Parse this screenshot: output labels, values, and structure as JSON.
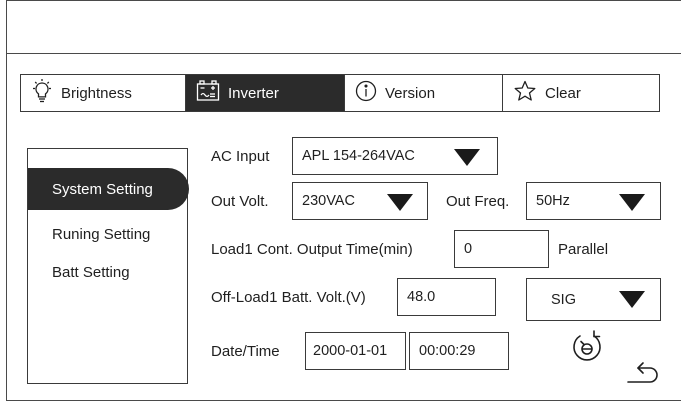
{
  "tabs": [
    {
      "label": "Brightness",
      "icon": "sun-icon",
      "active": false
    },
    {
      "label": "Inverter",
      "icon": "battery-icon",
      "active": true
    },
    {
      "label": "Version",
      "icon": "info-icon",
      "active": false
    },
    {
      "label": "Clear",
      "icon": "star-icon",
      "active": false
    }
  ],
  "sidebar": {
    "items": [
      {
        "label": "System Setting",
        "active": true
      },
      {
        "label": "Runing Setting",
        "active": false
      },
      {
        "label": "Batt Setting",
        "active": false
      }
    ]
  },
  "settings": {
    "ac_input": {
      "label": "AC Input",
      "value": "APL 154-264VAC"
    },
    "out_volt": {
      "label": "Out Volt.",
      "value": "230VAC"
    },
    "out_freq": {
      "label": "Out Freq.",
      "value": "50Hz"
    },
    "load1_time": {
      "label": "Load1 Cont. Output Time(min)",
      "value": "0"
    },
    "parallel": {
      "label": "Parallel"
    },
    "off_load1_volt": {
      "label": "Off-Load1 Batt. Volt.(V)",
      "value": "48.0"
    },
    "mode": {
      "value": "SIG"
    },
    "datetime": {
      "label": "Date/Time",
      "date": "2000-01-01",
      "time": "00:00:29"
    }
  },
  "icons": {
    "sync": "sync-icon",
    "back": "back-arrow-icon"
  },
  "colors": {
    "active_bg": "#2b2b2b",
    "border": "#3a3a3a",
    "background": "#ffffff"
  }
}
